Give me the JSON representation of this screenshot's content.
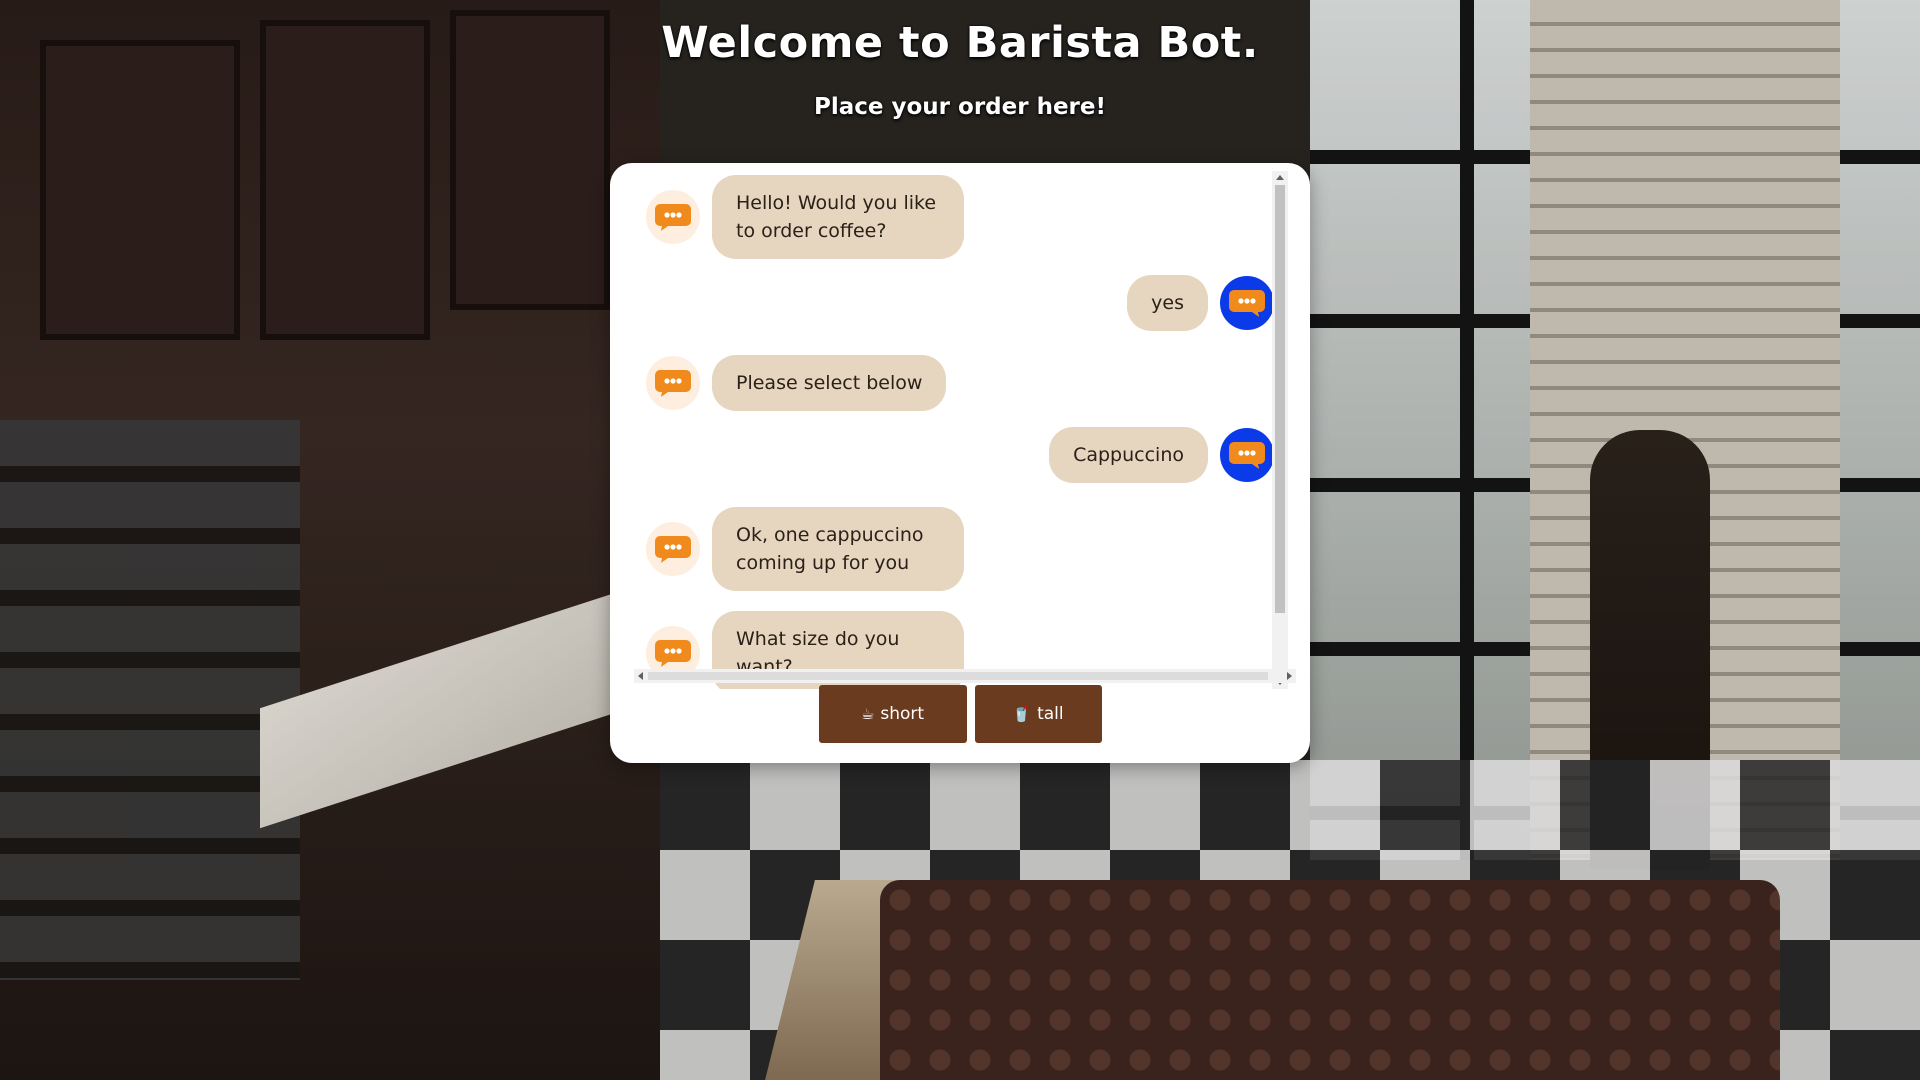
{
  "header": {
    "title": "Welcome to Barista Bot.",
    "subtitle": "Place your order here!"
  },
  "chat": {
    "messages": [
      {
        "sender": "bot",
        "text": "Hello! Would you like to order coffee?"
      },
      {
        "sender": "user",
        "text": "yes"
      },
      {
        "sender": "bot",
        "text": "Please select below"
      },
      {
        "sender": "user",
        "text": "Cappuccino"
      },
      {
        "sender": "bot",
        "text": "Ok, one cappuccino coming up for you"
      },
      {
        "sender": "bot",
        "text": "What size do you want?"
      }
    ],
    "bot_avatar_icon": "chat-bubble-icon",
    "user_avatar_icon": "chat-bubble-icon",
    "bot_accent": "#f08a1c",
    "user_avatar_color": "#0b3be8",
    "bubble_color": "#e6d5bf"
  },
  "quick_replies": [
    {
      "label": "short",
      "icon": "coffee-cup-icon"
    },
    {
      "label": "tall",
      "icon": "tall-cup-icon"
    }
  ],
  "colors": {
    "button": "#6b3b1f"
  }
}
